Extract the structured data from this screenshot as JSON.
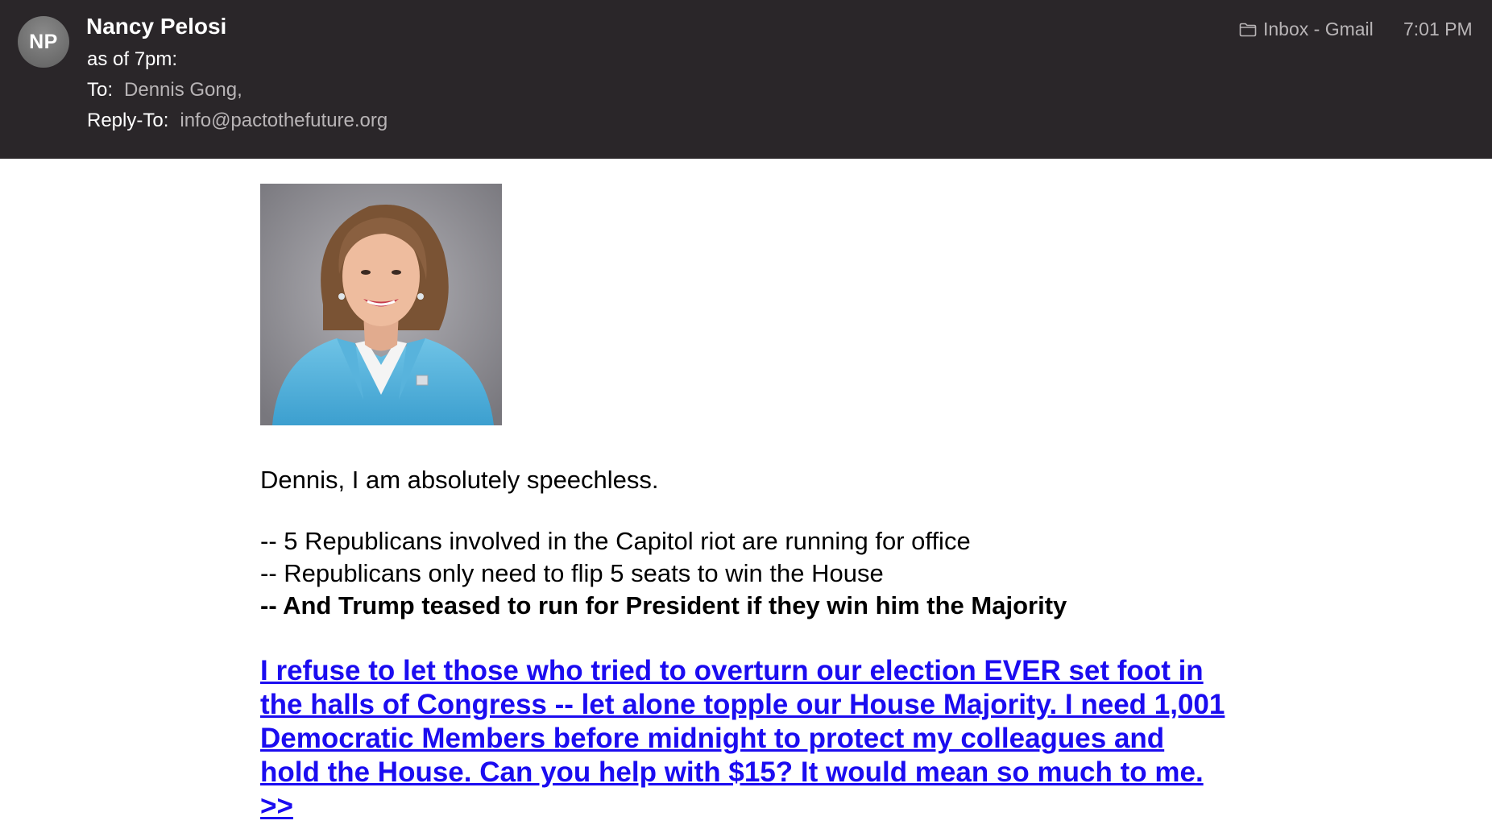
{
  "header": {
    "avatar_initials": "NP",
    "sender_name": "Nancy Pelosi",
    "subject": "as of 7pm:",
    "to_label": "To:",
    "to_value": "Dennis Gong,",
    "reply_label": "Reply-To:",
    "reply_value": "info@pactothefuture.org",
    "mailbox": "Inbox - Gmail",
    "time": "7:01 PM"
  },
  "body": {
    "greeting": "Dennis, I am absolutely speechless.",
    "bullets": [
      "-- 5 Republicans involved in the Capitol riot are running for office",
      "-- Republicans only need to flip 5 seats to win the House",
      "-- And Trump teased to run for President if they win him the Majority"
    ],
    "cta": "I refuse to let those who tried to overturn our election EVER set foot in the halls of Congress -- let alone topple our House Majority. I need 1,001 Democratic Members before midnight to protect my colleagues and hold the House. Can you help with $15? It would mean so much to me. >>"
  },
  "colors": {
    "header_bg": "#2a2629",
    "link": "#1b0cf0",
    "muted_text": "#b8b4b6"
  },
  "icons": {
    "mailbox": "folder-icon"
  }
}
